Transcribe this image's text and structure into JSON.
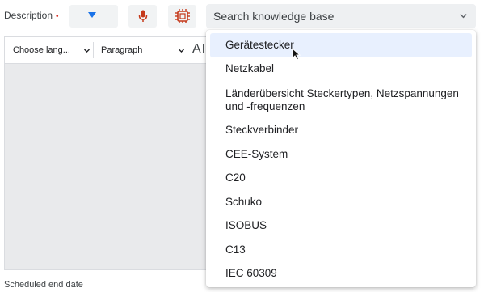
{
  "form": {
    "description_label": "Description",
    "required_mark": "•",
    "scheduled_end_date_label": "Scheduled end date"
  },
  "knowledge_base": {
    "placeholder": "Search knowledge base",
    "options": [
      "Gerätestecker",
      "Netzkabel",
      "Länderübersicht Steckertypen, Netzspannungen und -frequenzen",
      "Steckverbinder",
      "CEE-System",
      "C20",
      "Schuko",
      "ISOBUS",
      "C13",
      "IEC 60309"
    ],
    "highlighted_index": 0
  },
  "editor_toolbar": {
    "language_select": "Choose lang...",
    "paragraph_select": "Paragraph",
    "ai_label": "AI"
  },
  "icons": {
    "language_dropdown": "caret-down-icon",
    "microphone": "microphone-icon",
    "ai_chip": "ai-chip-icon",
    "chevron": "chevron-down-icon"
  },
  "colors": {
    "accent_blue": "#1a73e8",
    "icon_red": "#c5391a",
    "required_red": "#d93025",
    "highlight": "#e8f0fe"
  }
}
